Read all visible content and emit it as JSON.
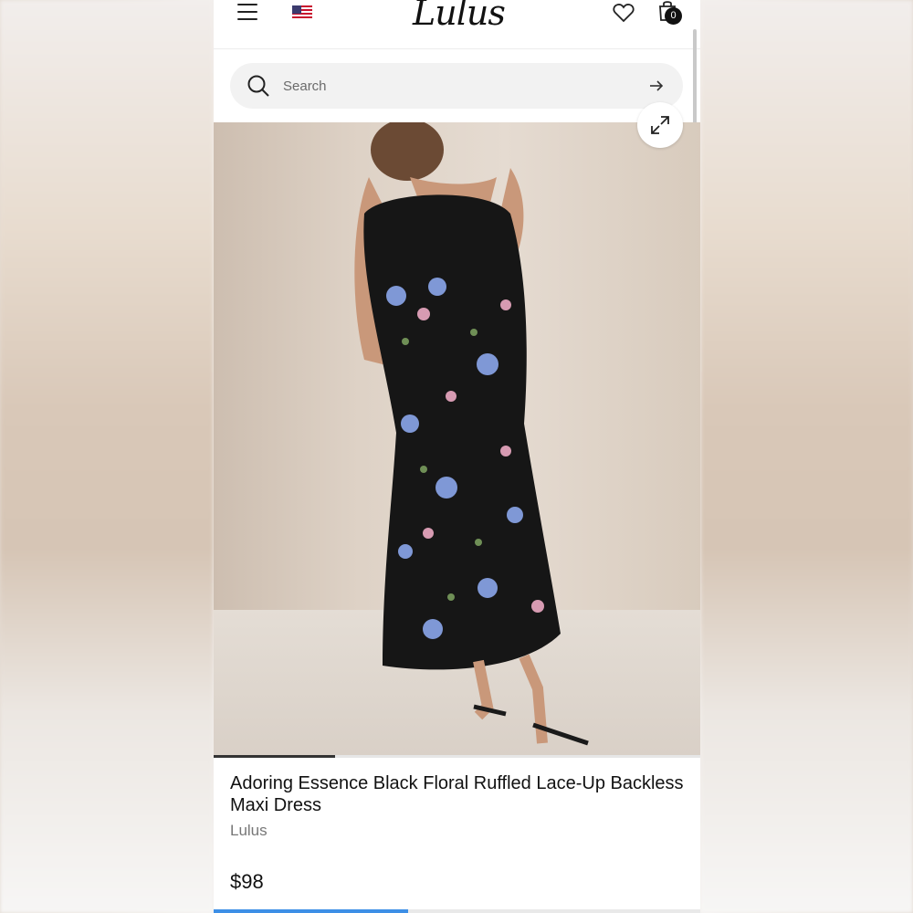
{
  "header": {
    "logo_text": "Lulus",
    "bag_count": "0",
    "icons": [
      "menu-icon",
      "us-flag-icon",
      "heart-icon",
      "shopping-bag-icon"
    ]
  },
  "search": {
    "placeholder": "Search"
  },
  "product": {
    "title": "Adoring Essence Black Floral Ruffled Lace-Up Backless Maxi Dress",
    "brand": "Lulus",
    "price": "$98",
    "image_description_icon": "expand-icon"
  },
  "carousel": {
    "progress": 0.25
  },
  "page_loading": {
    "progress": 0.4
  },
  "colors": {
    "accent_blue": "#3d8fe6",
    "text": "#111111",
    "muted": "#777777"
  }
}
